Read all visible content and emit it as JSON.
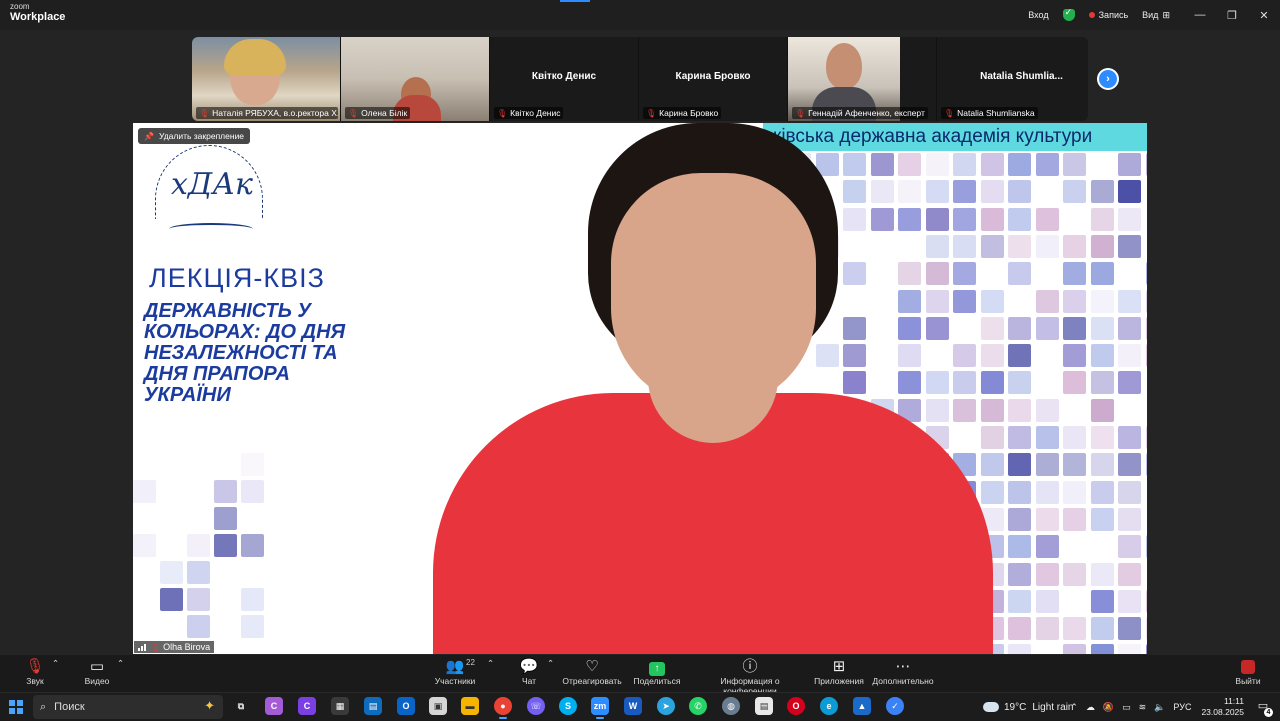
{
  "app": {
    "logo_top": "zoom",
    "logo_bottom": "Workplace"
  },
  "titlebar": {
    "login": "Вход",
    "record": "Запись",
    "view": "Вид",
    "minimize": "—",
    "restore": "❐",
    "close": "✕"
  },
  "gallery": [
    {
      "label": "Наталія РЯБУХА, в.о.ректора Х...",
      "video": true
    },
    {
      "label": "Олена Білік",
      "video": true
    },
    {
      "label": "Квітко Денис",
      "center_name": "Квітко Денис",
      "video": false
    },
    {
      "label": "Карина Бровко",
      "center_name": "Карина Бровко",
      "video": false
    },
    {
      "label": "Геннадій Афенченко, експерт",
      "video": true
    },
    {
      "label": "Natalia Shumlianska",
      "center_name": "Natalia  Shumlia...",
      "video": false
    }
  ],
  "gallery_next": "›",
  "stage": {
    "unpin_label": "Удалить закрепление",
    "banner": "ківська державна академія культури",
    "crest_letters": "хДАк",
    "lecture_title": "ЛЕКЦІЯ-КВІЗ",
    "lecture_subtitle": [
      "ДЕРЖАВНІСТЬ У",
      "КОЛЬОРАХ: ДО ДНЯ",
      "НЕЗАЛЕЖНОСТІ ТА",
      "ДНЯ ПРАПОРА",
      "УКРАЇНИ"
    ],
    "speaker_name": "Olha Birova"
  },
  "controls": {
    "audio": "Звук",
    "video": "Видео",
    "participants": "Участники",
    "participants_count": "22",
    "chat": "Чат",
    "react": "Отреагировать",
    "share": "Поделиться",
    "info": "Информация о конференции",
    "apps": "Приложения",
    "more": "Дополнительно",
    "leave": "Выйти"
  },
  "taskbar": {
    "search_placeholder": "Поиск",
    "weather_temp": "19°C",
    "weather_desc": "Light rain",
    "language": "РУС",
    "time": "11:11",
    "date": "23.08.2025",
    "notifications": "4"
  },
  "colors": {
    "accent": "#2d8cff",
    "share_green": "#22c55e",
    "rec_red": "#e53935",
    "shirt": "#e8343c",
    "banner": "#5fd9e0",
    "title_blue": "#1c3b9e"
  }
}
